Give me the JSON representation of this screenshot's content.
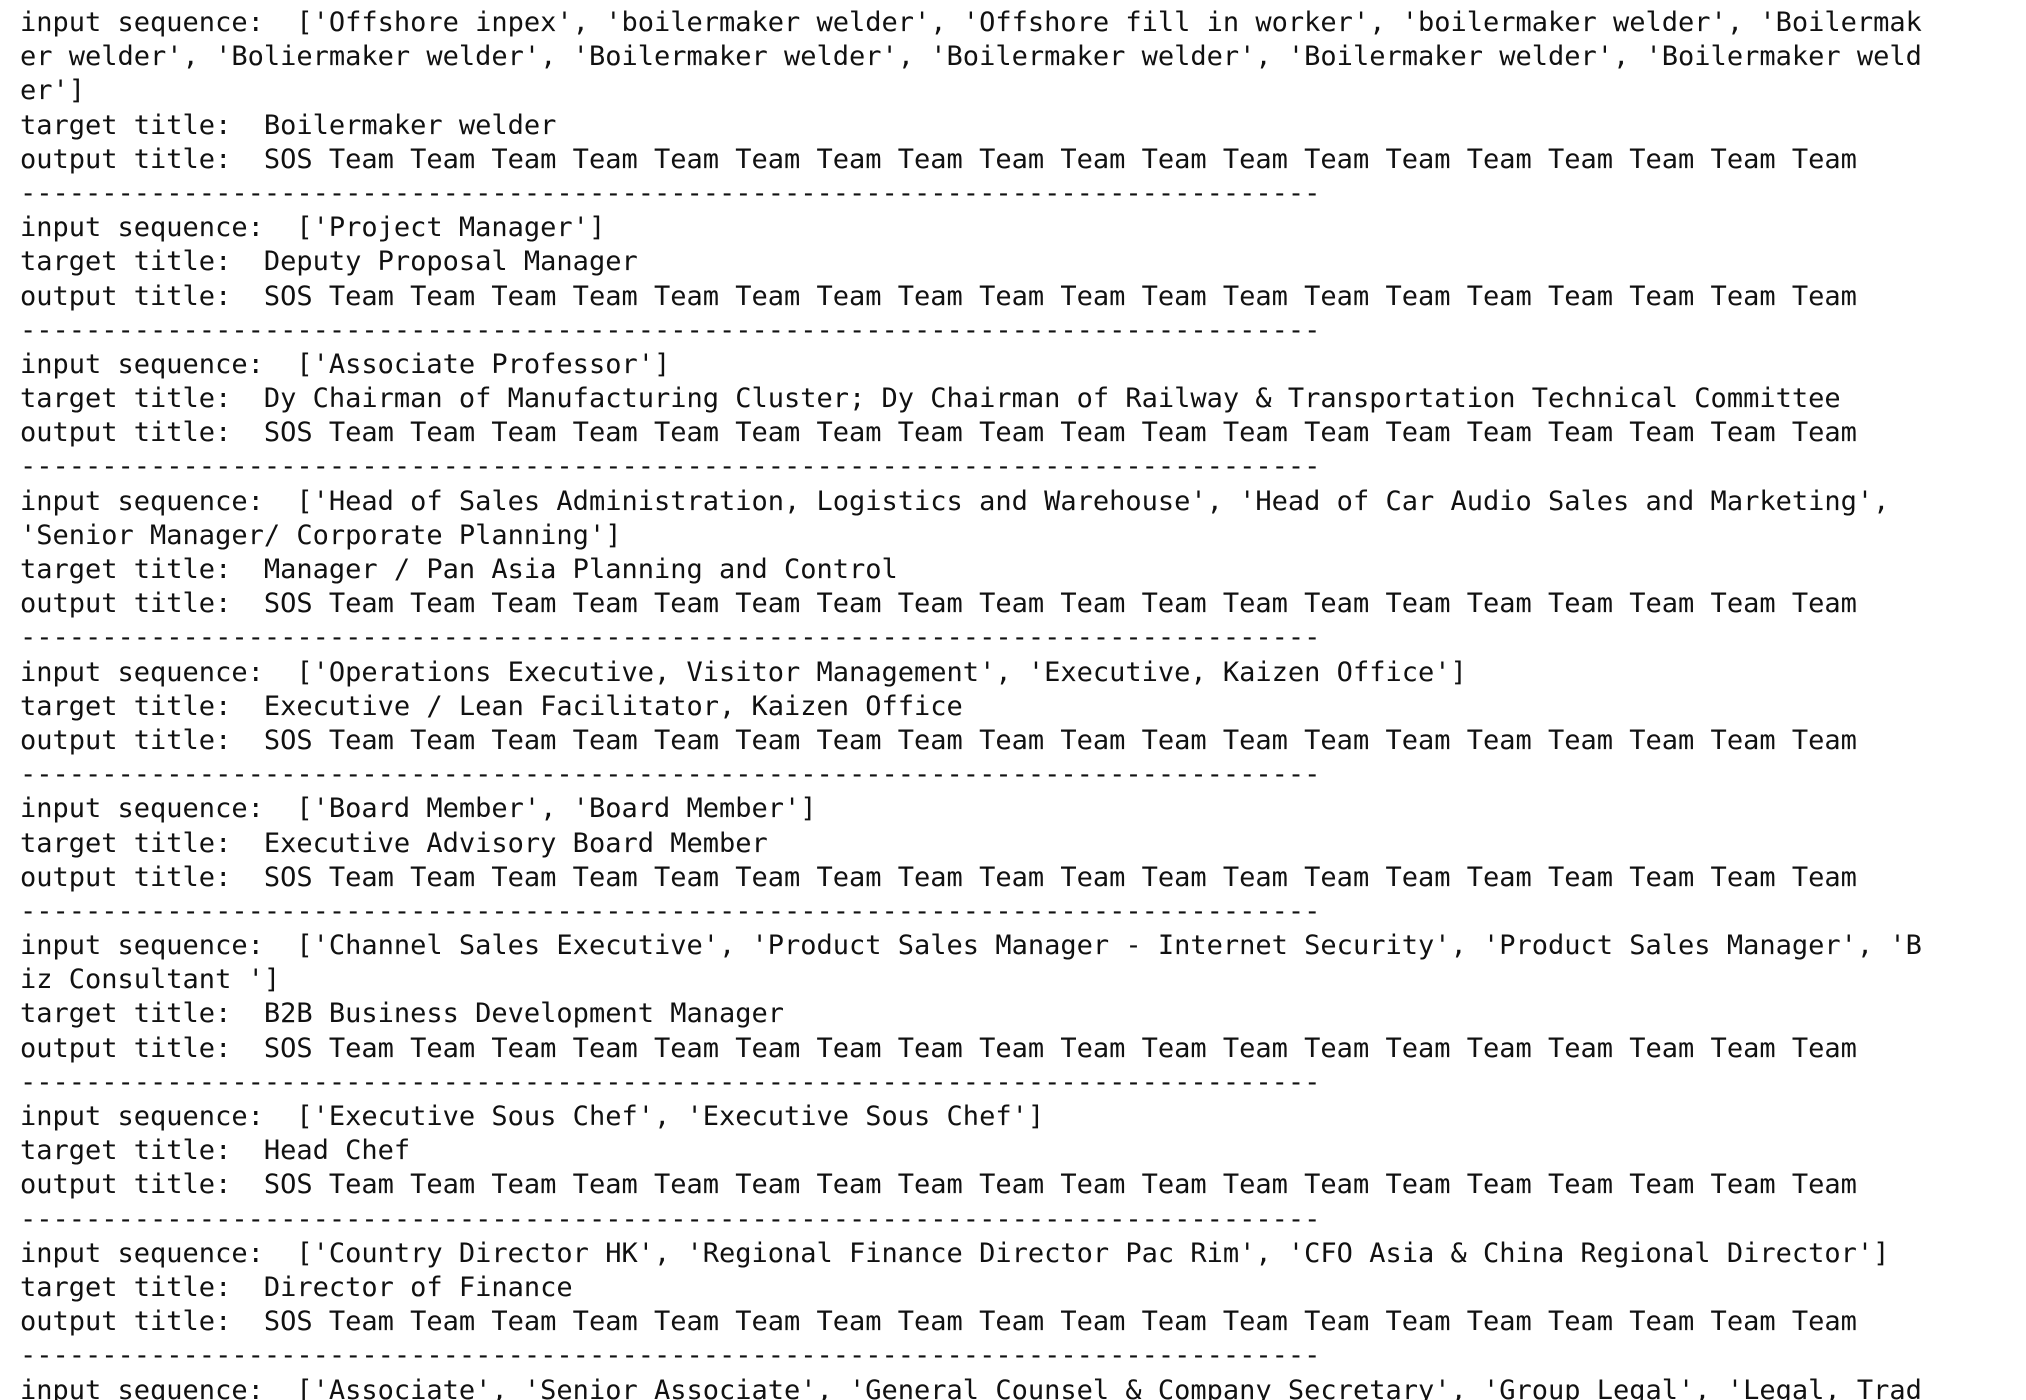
{
  "output": {
    "lines": [
      "input sequence:  ['Offshore inpex', 'boilermaker welder', 'Offshore fill in worker', 'boilermaker welder', 'Boilermak",
      "er welder', 'Boliermaker welder', 'Boilermaker welder', 'Boilermaker welder', 'Boilermaker welder', 'Boilermaker weld",
      "er']",
      "target title:  Boilermaker welder",
      "output title:  SOS Team Team Team Team Team Team Team Team Team Team Team Team Team Team Team Team Team Team Team",
      "--------------------------------------------------------------------------------",
      "input sequence:  ['Project Manager']",
      "target title:  Deputy Proposal Manager",
      "output title:  SOS Team Team Team Team Team Team Team Team Team Team Team Team Team Team Team Team Team Team Team",
      "--------------------------------------------------------------------------------",
      "input sequence:  ['Associate Professor']",
      "target title:  Dy Chairman of Manufacturing Cluster; Dy Chairman of Railway & Transportation Technical Committee",
      "output title:  SOS Team Team Team Team Team Team Team Team Team Team Team Team Team Team Team Team Team Team Team",
      "--------------------------------------------------------------------------------",
      "input sequence:  ['Head of Sales Administration, Logistics and Warehouse', 'Head of Car Audio Sales and Marketing',",
      "'Senior Manager/ Corporate Planning']",
      "target title:  Manager / Pan Asia Planning and Control",
      "output title:  SOS Team Team Team Team Team Team Team Team Team Team Team Team Team Team Team Team Team Team Team",
      "--------------------------------------------------------------------------------",
      "input sequence:  ['Operations Executive, Visitor Management', 'Executive, Kaizen Office']",
      "target title:  Executive / Lean Facilitator, Kaizen Office",
      "output title:  SOS Team Team Team Team Team Team Team Team Team Team Team Team Team Team Team Team Team Team Team",
      "--------------------------------------------------------------------------------",
      "input sequence:  ['Board Member', 'Board Member']",
      "target title:  Executive Advisory Board Member",
      "output title:  SOS Team Team Team Team Team Team Team Team Team Team Team Team Team Team Team Team Team Team Team",
      "--------------------------------------------------------------------------------",
      "input sequence:  ['Channel Sales Executive', 'Product Sales Manager - Internet Security', 'Product Sales Manager', 'B",
      "iz Consultant ']",
      "target title:  B2B Business Development Manager",
      "output title:  SOS Team Team Team Team Team Team Team Team Team Team Team Team Team Team Team Team Team Team Team",
      "--------------------------------------------------------------------------------",
      "input sequence:  ['Executive Sous Chef', 'Executive Sous Chef']",
      "target title:  Head Chef",
      "output title:  SOS Team Team Team Team Team Team Team Team Team Team Team Team Team Team Team Team Team Team Team",
      "--------------------------------------------------------------------------------",
      "input sequence:  ['Country Director HK', 'Regional Finance Director Pac Rim', 'CFO Asia & China Regional Director']",
      "target title:  Director of Finance",
      "output title:  SOS Team Team Team Team Team Team Team Team Team Team Team Team Team Team Team Team Team Team Team",
      "--------------------------------------------------------------------------------",
      "input sequence:  ['Associate', 'Senior Associate', 'General Counsel & Company Secretary', 'Group Legal', 'Legal, Trad"
    ]
  }
}
